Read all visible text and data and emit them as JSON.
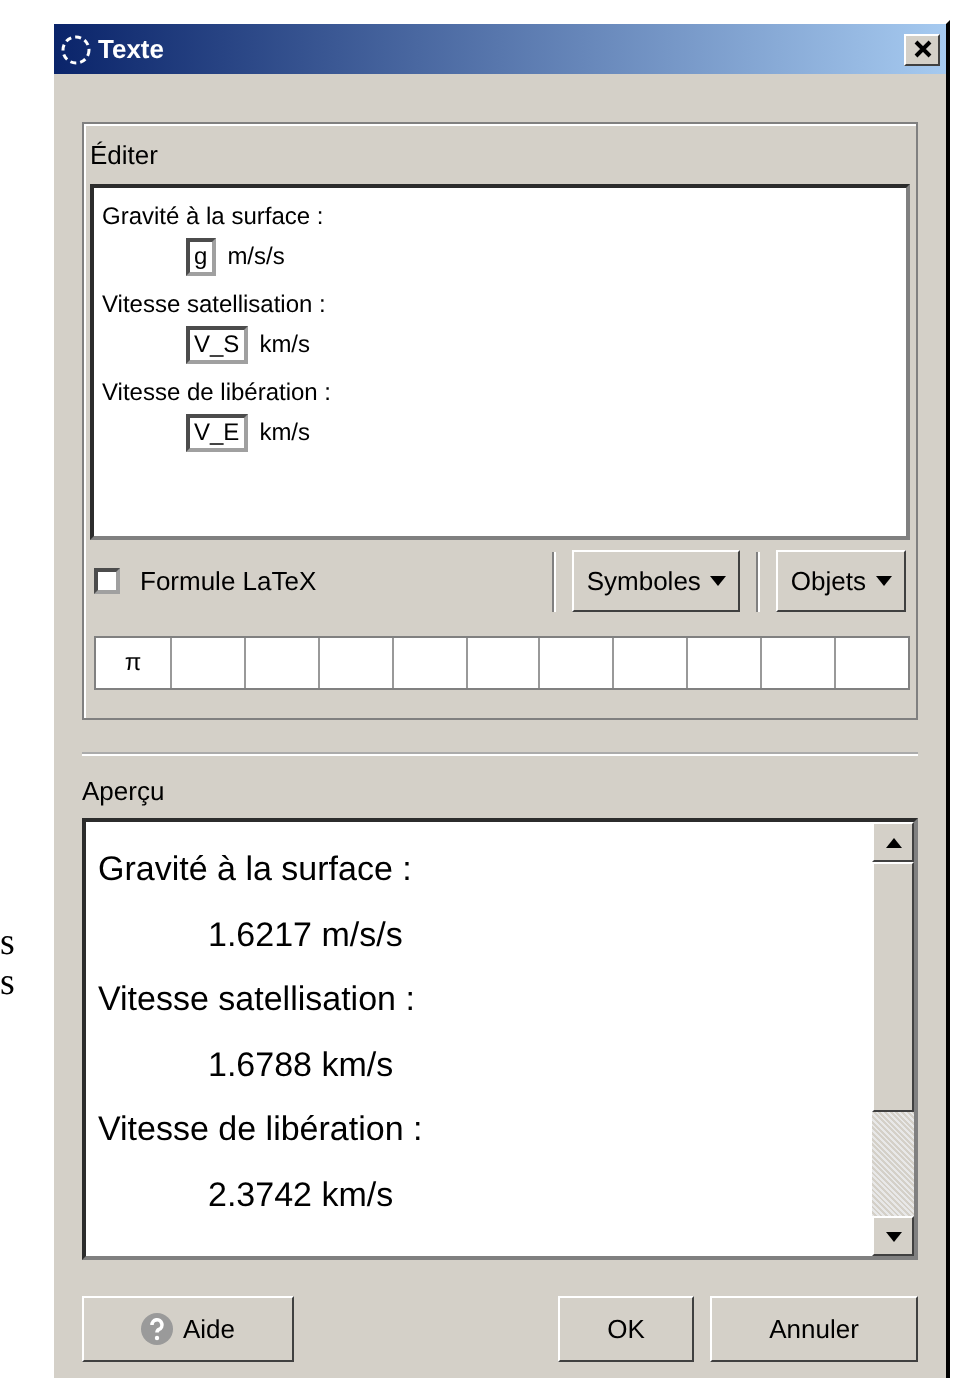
{
  "window": {
    "title": "Texte"
  },
  "background_text": [
    "s",
    "s"
  ],
  "edit": {
    "label": "Éditer",
    "lines": [
      {
        "kind": "text",
        "text": "Gravité à la surface :"
      },
      {
        "kind": "field",
        "value": "g",
        "unit": "m/s/s"
      },
      {
        "kind": "text",
        "text": "Vitesse satellisation :"
      },
      {
        "kind": "field",
        "value": "V_S",
        "unit": "km/s"
      },
      {
        "kind": "text",
        "text": "Vitesse de libération :"
      },
      {
        "kind": "field",
        "value": "V_E",
        "unit": "km/s"
      }
    ]
  },
  "latex": {
    "label": "Formule LaTeX",
    "checked": false
  },
  "menus": [
    "Symboles",
    "Objets"
  ],
  "symbols": [
    "π"
  ],
  "preview": {
    "label": "Aperçu",
    "lines": [
      {
        "kind": "label",
        "text": "Gravité à la surface :"
      },
      {
        "kind": "value",
        "text": "1.6217 m/s/s"
      },
      {
        "kind": "label",
        "text": "Vitesse satellisation :"
      },
      {
        "kind": "value",
        "text": "1.6788 km/s"
      },
      {
        "kind": "label",
        "text": "Vitesse de libération :"
      },
      {
        "kind": "value",
        "text": "2.3742 km/s"
      }
    ]
  },
  "buttons": [
    {
      "kind": "help",
      "label": "Aide"
    },
    {
      "kind": "ok",
      "label": "OK"
    },
    {
      "kind": "cancel",
      "label": "Annuler"
    }
  ]
}
